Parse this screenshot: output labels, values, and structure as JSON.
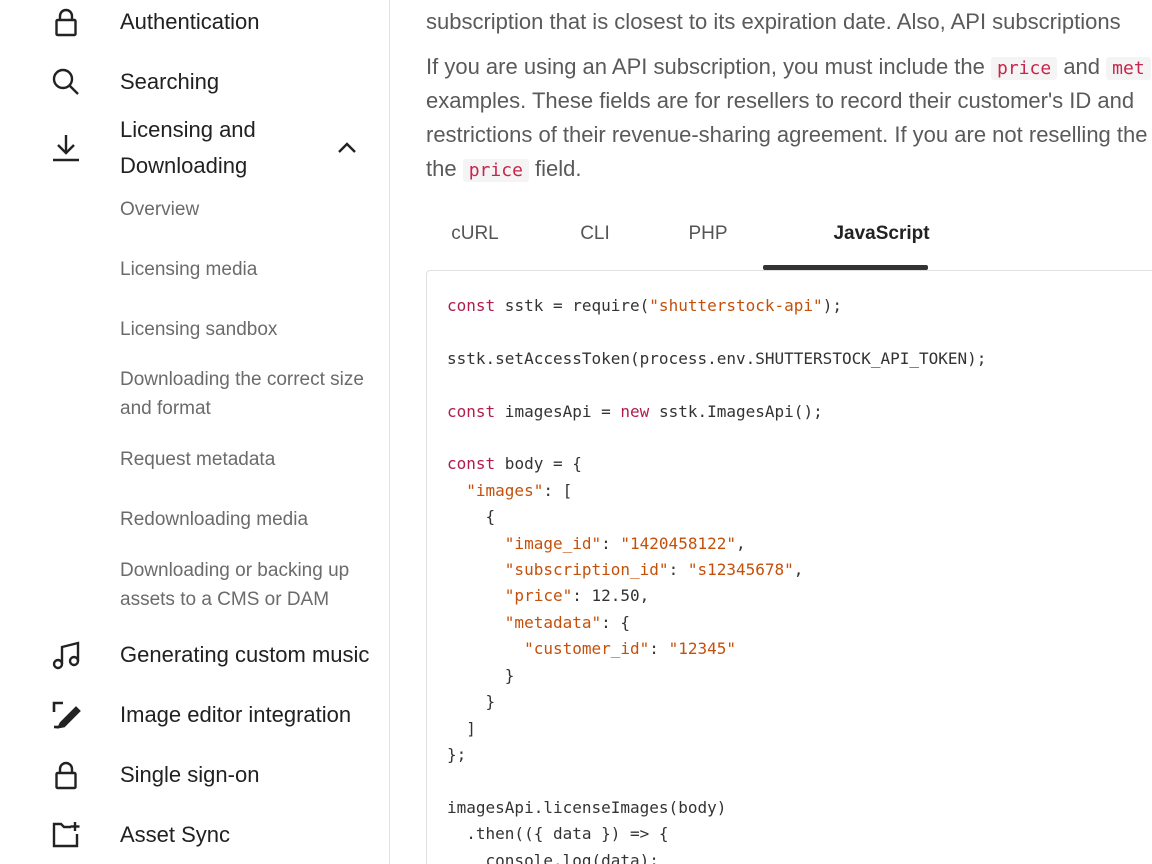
{
  "sidebar": {
    "items": [
      {
        "label": "Authentication",
        "icon": "lock-icon"
      },
      {
        "label": "Searching",
        "icon": "search-icon"
      },
      {
        "label": "Licensing and Downloading",
        "icon": "download-icon",
        "expanded": true
      },
      {
        "label": "Generating custom music",
        "icon": "music-note-icon"
      },
      {
        "label": "Image editor integration",
        "icon": "edit-icon"
      },
      {
        "label": "Single sign-on",
        "icon": "lock-icon"
      },
      {
        "label": "Asset Sync",
        "icon": "folder-add-icon"
      }
    ],
    "subitems": [
      "Overview",
      "Licensing media",
      "Licensing sandbox",
      "Downloading the correct size and format",
      "Request metadata",
      "Redownloading media",
      "Downloading or backing up assets to a CMS or DAM"
    ]
  },
  "content": {
    "line1": "subscription that is closest to its expiration date. Also, API subscriptions",
    "p2": {
      "a": "If you are using an API subscription, you must include the",
      "code1": "price",
      "b": "and",
      "code2": "met",
      "line2": "examples. These fields are for resellers to record their customer's ID and",
      "line3": "restrictions of their revenue-sharing agreement. If you are not reselling the",
      "c": "the",
      "code3": "price",
      "d": "field."
    }
  },
  "tabs": [
    "cURL",
    "CLI",
    "PHP",
    "JavaScript"
  ],
  "active_tab": "JavaScript",
  "code": {
    "kw_const": "const",
    "kw_new": "new",
    "l1_a": " sstk = require(",
    "l1_str": "\"shutterstock-api\"",
    "l1_b": ");",
    "l3": "sstk.setAccessToken(process.env.SHUTTERSTOCK_API_TOKEN);",
    "l5_a": " imagesApi = ",
    "l5_b": " sstk.ImagesApi();",
    "l7_a": " body = {",
    "k_images": "\"images\"",
    "l8_b": ": [",
    "l9": "    {",
    "k_image_id": "\"image_id\"",
    "v_image_id": "\"1420458122\"",
    "k_subscription_id": "\"subscription_id\"",
    "v_subscription_id": "\"s12345678\"",
    "k_price": "\"price\"",
    "v_price": "12.50",
    "k_metadata": "\"metadata\"",
    "k_customer_id": "\"customer_id\"",
    "v_customer_id": "\"12345\"",
    "l15": "      }",
    "l16": "    }",
    "l17": "  ]",
    "l18": "};",
    "l20": "imagesApi.licenseImages(body)",
    "l21": "  .then(({ data }) => {",
    "l22": "    console.log(data);"
  }
}
